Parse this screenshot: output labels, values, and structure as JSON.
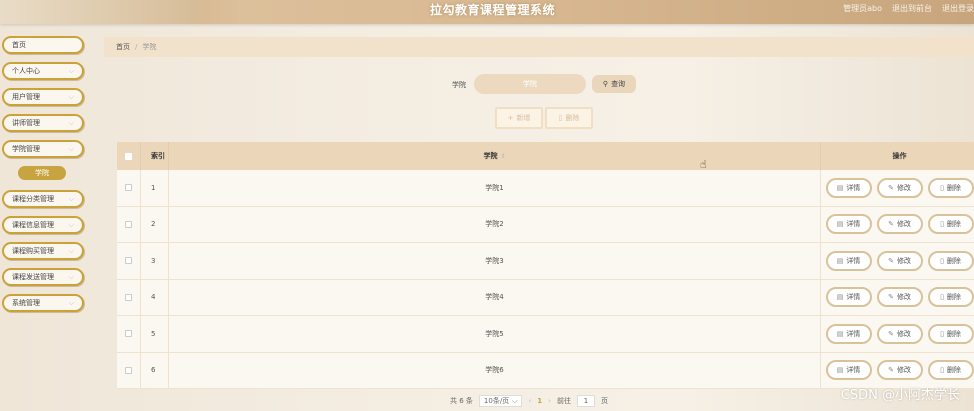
{
  "header": {
    "title": "拉勾教育课程管理系统",
    "links": [
      "管理员abo",
      "退出到前台",
      "退出登录"
    ]
  },
  "sidebar": {
    "items": [
      {
        "label": "首页",
        "has_chevron": false
      },
      {
        "label": "个人中心",
        "has_chevron": true
      },
      {
        "label": "用户管理",
        "has_chevron": true
      },
      {
        "label": "讲师管理",
        "has_chevron": true
      },
      {
        "label": "学院管理",
        "has_chevron": true
      },
      {
        "label": "课程分类管理",
        "has_chevron": true
      },
      {
        "label": "课程信息管理",
        "has_chevron": true
      },
      {
        "label": "课程购买管理",
        "has_chevron": true
      },
      {
        "label": "课程发送管理",
        "has_chevron": true
      },
      {
        "label": "系统管理",
        "has_chevron": true
      }
    ],
    "active_sub": "学院"
  },
  "breadcrumb": {
    "home": "首页",
    "separator": "/",
    "current": "学院"
  },
  "search": {
    "label": "学院",
    "placeholder": "学院",
    "button_label": "查询"
  },
  "actions": {
    "add_label": "新增",
    "delete_label": "删除"
  },
  "table": {
    "headers": {
      "index": "索引",
      "name": "学院",
      "ops": "操作"
    },
    "rows": [
      {
        "index": "1",
        "name": "学院1"
      },
      {
        "index": "2",
        "name": "学院2"
      },
      {
        "index": "3",
        "name": "学院3"
      },
      {
        "index": "4",
        "name": "学院4"
      },
      {
        "index": "5",
        "name": "学院5"
      },
      {
        "index": "6",
        "name": "学院6"
      }
    ],
    "row_buttons": {
      "detail": "详情",
      "edit": "修改",
      "delete": "删除"
    }
  },
  "pagination": {
    "total": "共 6 条",
    "page_size": "10条/页",
    "current_page": "1",
    "goto_label": "前往",
    "goto_value": "1",
    "page_suffix": "页"
  },
  "watermark": "CSDN @小阿杰学长",
  "colors": {
    "accent": "#c8a440",
    "header": "#d6b68d",
    "table_head": "#ecd6ba"
  },
  "icons": [
    "search-icon",
    "plus-icon",
    "trash-icon",
    "document-icon",
    "edit-icon",
    "chevron-down-icon",
    "pointer-cursor-icon"
  ]
}
